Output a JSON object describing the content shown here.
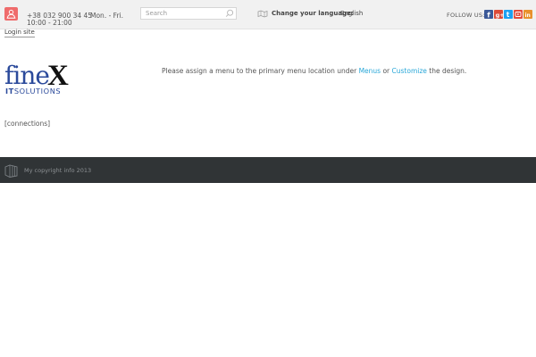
{
  "topbar": {
    "phone": "+38 032 900 34 45",
    "hours": "Mon. - Fri. 10:00 - 21:00",
    "search": {
      "placeholder": "Search",
      "value": ""
    },
    "language": {
      "label": "Change your language:",
      "value": "English"
    },
    "follow_label": "FOLLOW US:",
    "social": [
      {
        "icon": "facebook-icon",
        "color": "#3b5998",
        "glyph": "f"
      },
      {
        "icon": "google-plus-icon",
        "color": "#dd4b39",
        "glyph": "g"
      },
      {
        "icon": "twitter-icon",
        "color": "#1da1f2",
        "glyph": "t"
      },
      {
        "icon": "youtube-icon",
        "color": "#e44b3b",
        "glyph": "y"
      },
      {
        "icon": "linkedin-icon",
        "color": "#e8912d",
        "glyph": "in"
      }
    ]
  },
  "header": {
    "login_link": "Login site",
    "logo": {
      "word": "fineX",
      "tagline": "ITSOLUTIONS"
    },
    "menu_message": {
      "before": "Please assign a menu to the primary menu location under ",
      "menus_link": "Menus",
      "middle": " or ",
      "customize_link": "Customize",
      "after": " the design."
    }
  },
  "content": {
    "shortcode": "[connections]"
  },
  "footer": {
    "copyright": "My copyright info 2013"
  },
  "colors": {
    "topbar_bg": "#f1f1f1",
    "user_button": "#ef6b6b",
    "link": "#29a7d8",
    "logo_blue": "#2b4a9b",
    "footer_bg": "#303436"
  }
}
